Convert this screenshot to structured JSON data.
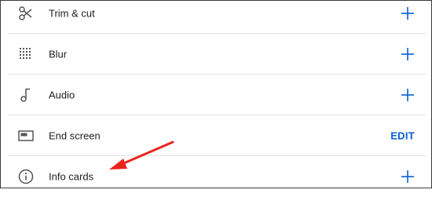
{
  "rows": [
    {
      "label": "Trim & cut",
      "icon": "scissors-icon",
      "action": "add"
    },
    {
      "label": "Blur",
      "icon": "blur-grid-icon",
      "action": "add"
    },
    {
      "label": "Audio",
      "icon": "music-note-icon",
      "action": "add"
    },
    {
      "label": "End screen",
      "icon": "end-screen-icon",
      "action": "EDIT"
    },
    {
      "label": "Info cards",
      "icon": "info-icon",
      "action": "add"
    }
  ],
  "colors": {
    "accent": "#065fd4",
    "annotation_arrow": "#e8251c",
    "divider": "#e3e3e3",
    "text": "#202020",
    "icon": "#555555"
  }
}
